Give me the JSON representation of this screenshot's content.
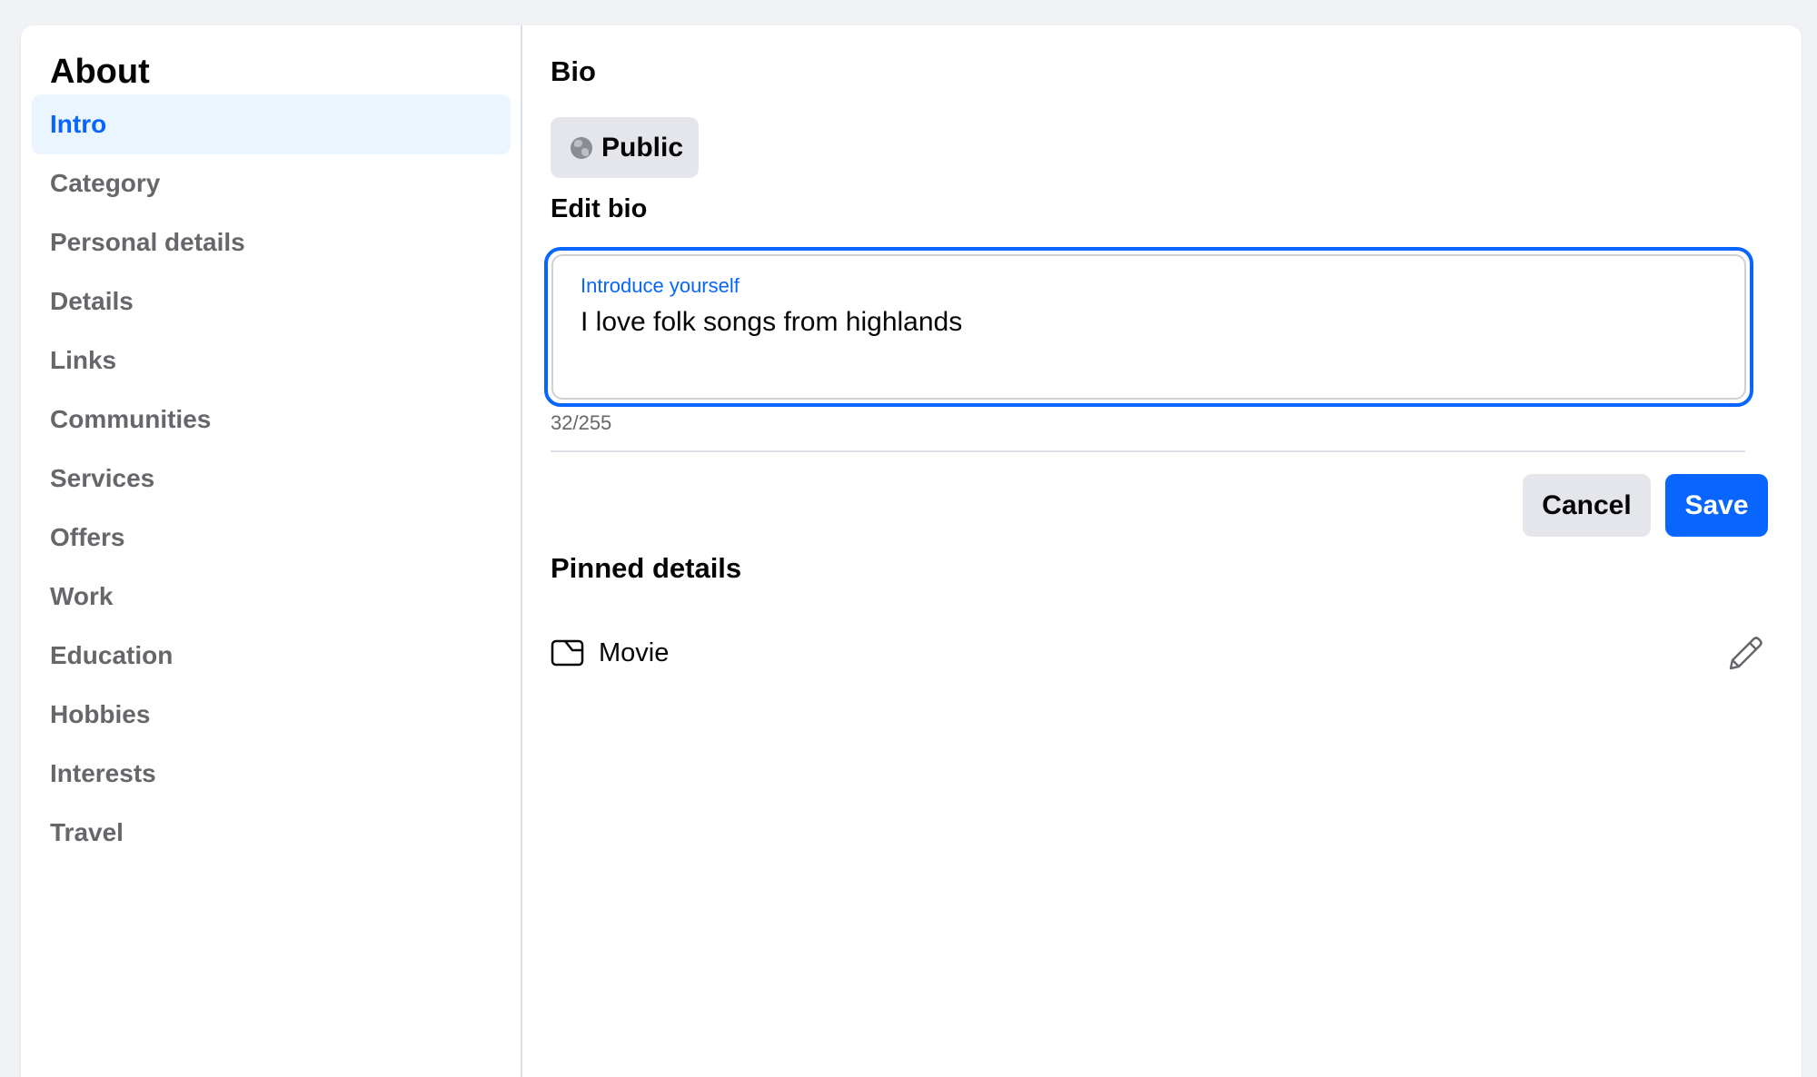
{
  "sidebar": {
    "title": "About",
    "items": [
      {
        "label": "Intro",
        "active": true
      },
      {
        "label": "Category"
      },
      {
        "label": "Personal details"
      },
      {
        "label": "Details"
      },
      {
        "label": "Links"
      },
      {
        "label": "Communities"
      },
      {
        "label": "Services"
      },
      {
        "label": "Offers"
      },
      {
        "label": "Work"
      },
      {
        "label": "Education"
      },
      {
        "label": "Hobbies"
      },
      {
        "label": "Interests"
      },
      {
        "label": "Travel"
      }
    ]
  },
  "bio": {
    "title": "Bio",
    "privacy_label": "Public",
    "privacy_icon": "globe-icon",
    "edit_label": "Edit bio",
    "field_label": "Introduce yourself",
    "field_value": "I love folk songs from highlands",
    "counter": "32/255",
    "cancel_label": "Cancel",
    "save_label": "Save"
  },
  "pinned": {
    "title": "Pinned details",
    "items": [
      {
        "label": "Movie",
        "icon": "movie-icon",
        "action_icon": "pencil-icon"
      }
    ]
  },
  "colors": {
    "accent": "#0866ff",
    "active_bg": "#ebf5ff",
    "muted_text": "#65676b",
    "button_gray": "#e4e6eb"
  }
}
